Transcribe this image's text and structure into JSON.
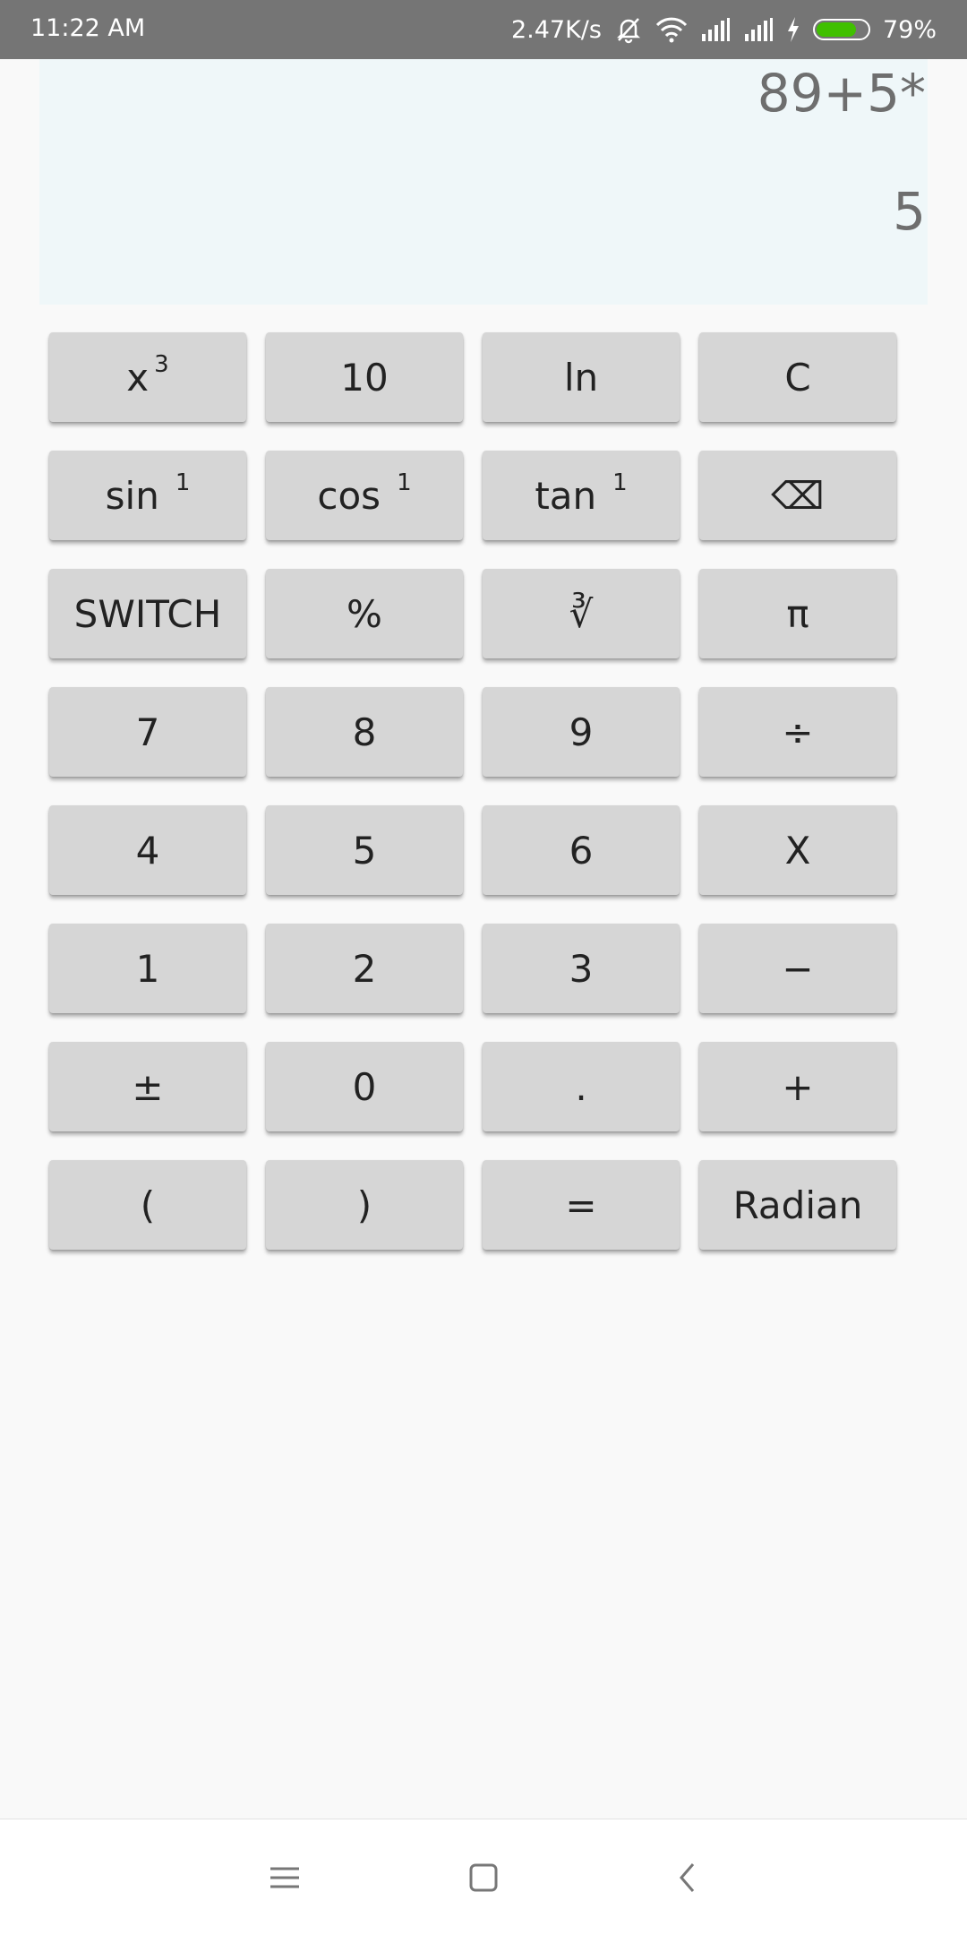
{
  "status_bar": {
    "time": "11:22 AM",
    "net_speed": "2.47K/s",
    "battery_pct": "79%",
    "battery_level": 0.79,
    "battery_color": "#40c000",
    "icons": [
      "mute-bell-icon",
      "wifi-icon",
      "signal-icon",
      "signal-icon",
      "charging-icon",
      "battery-icon"
    ]
  },
  "display": {
    "expression": "89+5*",
    "result": "5",
    "background": "#eff7f9"
  },
  "keys": {
    "cube": {
      "base": "x",
      "sup": "3"
    },
    "ten": {
      "label": "10"
    },
    "ln": {
      "label": "ln"
    },
    "clear": {
      "label": "C"
    },
    "asin": {
      "base": "sin",
      "sup": "1"
    },
    "acos": {
      "base": "cos",
      "sup": "1"
    },
    "atan": {
      "base": "tan",
      "sup": "1"
    },
    "backspace": {
      "label": "⌫",
      "icon": "backspace-icon"
    },
    "switch": {
      "label": "SWITCH"
    },
    "percent": {
      "label": "%"
    },
    "cbrt": {
      "label": "∛"
    },
    "pi": {
      "label": "π"
    },
    "seven": {
      "label": "7"
    },
    "eight": {
      "label": "8"
    },
    "nine": {
      "label": "9"
    },
    "divide": {
      "label": "÷"
    },
    "four": {
      "label": "4"
    },
    "five": {
      "label": "5"
    },
    "six": {
      "label": "6"
    },
    "multiply": {
      "label": "X"
    },
    "one": {
      "label": "1"
    },
    "two": {
      "label": "2"
    },
    "three": {
      "label": "3"
    },
    "minus": {
      "label": "−"
    },
    "plusminus": {
      "label": "±"
    },
    "zero": {
      "label": "0"
    },
    "dot": {
      "label": "."
    },
    "plus": {
      "label": "+"
    },
    "lparen": {
      "label": "("
    },
    "rparen": {
      "label": ")"
    },
    "equals": {
      "label": "="
    },
    "radian": {
      "label": "Radian"
    }
  },
  "nav_bar": {
    "icons": [
      "menu-icon",
      "home-icon",
      "back-icon"
    ]
  }
}
